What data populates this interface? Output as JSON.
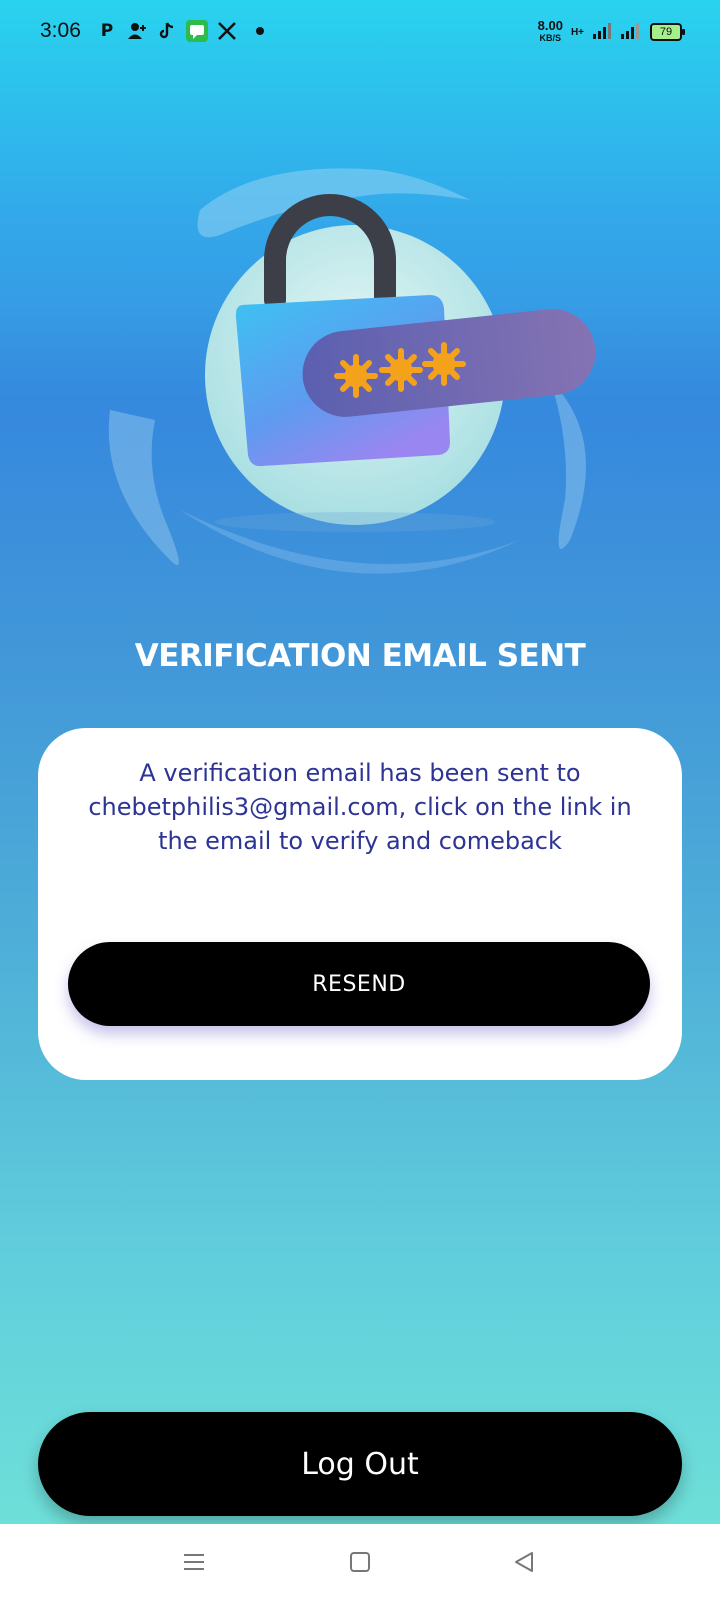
{
  "status_bar": {
    "time": "3:06",
    "notification_icons": [
      "parking-p-icon",
      "add-contact-icon",
      "tiktok-icon",
      "messages-icon",
      "x-icon",
      "dot-icon"
    ],
    "network_speed": "8.00",
    "network_speed_unit": "KB/S",
    "network_type": "H+",
    "battery_level": "79"
  },
  "hero": {
    "icon": "padlock-password-icon",
    "password_mask": "***",
    "colors": {
      "lock_body": "#3aa9ec",
      "password_bar": "#6e67b3",
      "asterisk": "#f4a21c",
      "disc": "#c7ecec"
    }
  },
  "page": {
    "title": "VERIFICATION EMAIL SENT"
  },
  "card": {
    "message": "A verification email has been sent to chebetphilis3@gmail.com, click on the link in the email to verify and comeback",
    "resend_label": "RESEND"
  },
  "logout_label": "Log Out",
  "nav": {
    "icons": [
      "menu-icon",
      "home-square-icon",
      "back-triangle-icon"
    ]
  },
  "colors": {
    "message_text": "#2d3494",
    "button_bg": "#000000",
    "title_text": "#ffffff"
  }
}
